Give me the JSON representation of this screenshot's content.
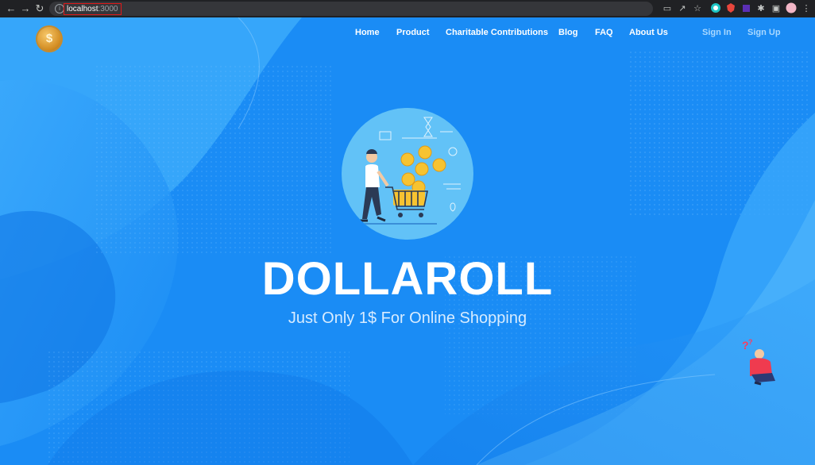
{
  "browser": {
    "url_host": "localhost",
    "url_port": ":3000",
    "back_icon": "arrow-left-icon",
    "forward_icon": "arrow-right-icon",
    "reload_icon": "reload-icon",
    "info_icon": "info-icon"
  },
  "nav": {
    "logo_icon": "dollar-coin-icon",
    "logo_glyph": "$",
    "items": [
      {
        "label": "Home"
      },
      {
        "label": "Product"
      },
      {
        "label": "Charitable Contributions"
      },
      {
        "label": "Blog"
      },
      {
        "label": "FAQ"
      },
      {
        "label": "About Us"
      }
    ],
    "sign_in": "Sign In",
    "sign_up": "Sign Up"
  },
  "hero": {
    "title": "DOLLAROLL",
    "subtitle": "Just Only 1$ For Online Shopping",
    "illustration": "shopping-cart-coins-illustration",
    "helper_illustration": "confused-person-illustration"
  },
  "colors": {
    "bg_main": "#1a8cf5",
    "bg_light": "#3aa8fb",
    "bg_dark": "#0f74e4",
    "circle": "#62c2f7",
    "coin": "#f7c331",
    "url_highlight": "#e01919"
  }
}
